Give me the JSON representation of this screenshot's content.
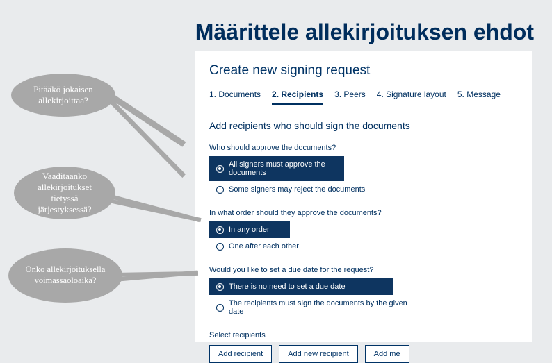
{
  "page_title": "Määrittele allekirjoituksen ehdot",
  "panel_title": "Create new signing request",
  "steps": [
    {
      "label": "1. Documents",
      "active": false
    },
    {
      "label": "2. Recipients",
      "active": true
    },
    {
      "label": "3. Peers",
      "active": false
    },
    {
      "label": "4. Signature layout",
      "active": false
    },
    {
      "label": "5. Message",
      "active": false
    }
  ],
  "section_heading": "Add recipients who should sign the documents",
  "q1": {
    "label": "Who should approve the documents?",
    "opt_selected": "All signers must approve the documents",
    "opt_other": "Some signers may reject the documents"
  },
  "q2": {
    "label": "In what order should they approve the documents?",
    "opt_selected": "In any order",
    "opt_other": "One after each other"
  },
  "q3": {
    "label": "Would you like to set a due date for the request?",
    "opt_selected": "There is no need to set a due date",
    "opt_other": "The recipients must sign the documents by the given date"
  },
  "select_recipients_label": "Select recipients",
  "buttons": {
    "add_recipient": "Add recipient",
    "add_new_recipient": "Add new recipient",
    "add_me": "Add me"
  },
  "callouts": {
    "c1": "Pitääkö jokaisen allekirjoittaa?",
    "c2": "Vaaditaanko allekirjoitukset tietyssä järjestyksessä?",
    "c3": "Onko allekirjoituksella voimassaoloaika?"
  }
}
